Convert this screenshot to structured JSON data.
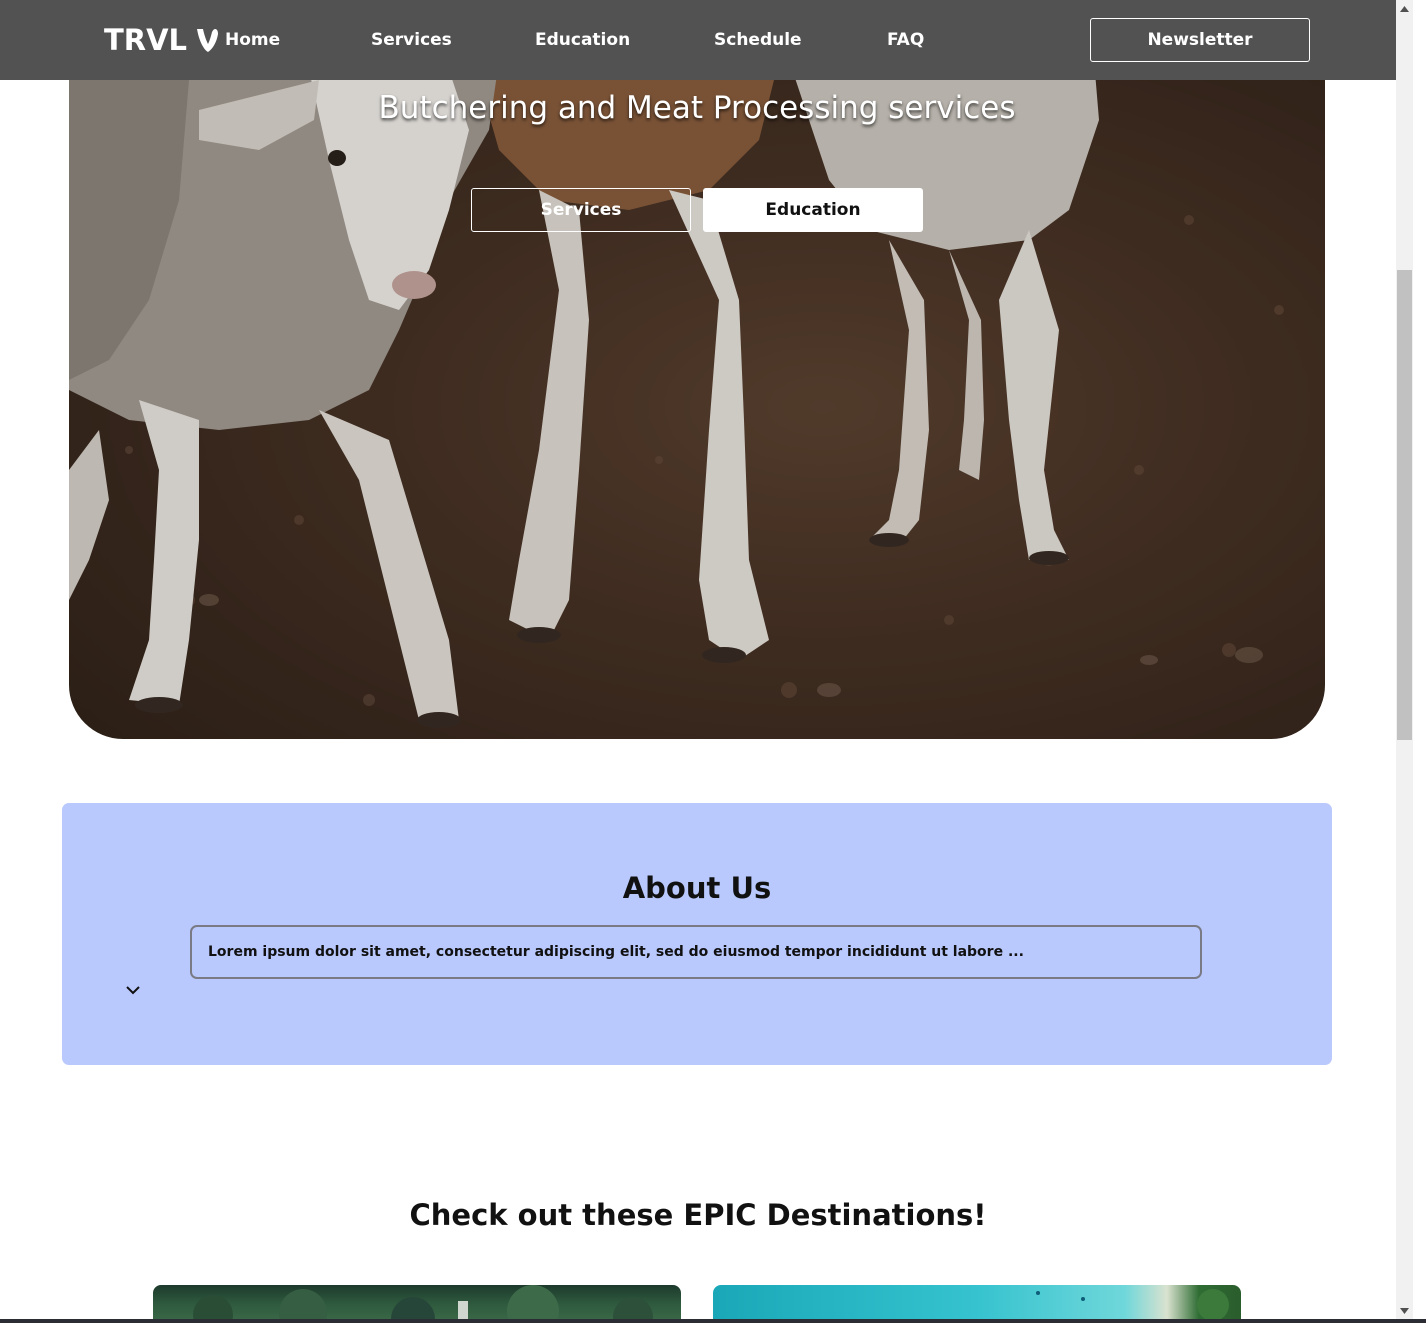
{
  "nav": {
    "logo_text": "TRVL",
    "logo_icon": "typo3-icon",
    "links": [
      "Home",
      "Services",
      "Education",
      "Schedule",
      "FAQ"
    ],
    "newsletter_label": "Newsletter"
  },
  "hero": {
    "subtitle": "Butchering and Meat Processing services",
    "button_services": "Services",
    "button_education": "Education"
  },
  "about": {
    "title": "About Us",
    "text": "Lorem ipsum dolor sit amet, consectetur adipiscing elit, sed do eiusmod tempor incididunt ut labore ...",
    "expand_icon": "chevron-down-icon"
  },
  "destinations": {
    "title": "Check out these EPIC Destinations!"
  },
  "colors": {
    "nav_bg": "#525252",
    "about_bg": "#b9c8fd"
  }
}
